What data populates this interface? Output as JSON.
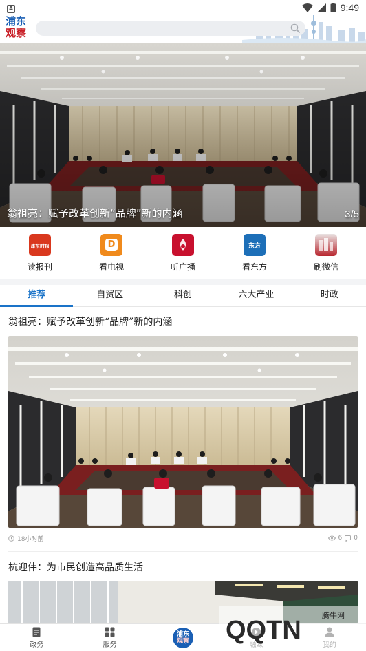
{
  "status_bar": {
    "time": "9:49",
    "icons": [
      "a-icon",
      "wifi-icon",
      "signal-icon",
      "battery-icon"
    ]
  },
  "header": {
    "logo_line1": "浦东",
    "logo_line2": "观察",
    "search": {
      "value": "",
      "placeholder": ""
    }
  },
  "banner": {
    "caption": "翁祖亮：赋予改革创新“品牌”新的内涵",
    "pager": "3/5"
  },
  "shortcuts": [
    {
      "label": "读报刊",
      "icon": "newspaper-icon",
      "color": "#d9381e",
      "glyph": "浦东时报"
    },
    {
      "label": "看电视",
      "icon": "tv-icon",
      "color": "#f08a1c",
      "glyph": "D"
    },
    {
      "label": "听广播",
      "icon": "radio-icon",
      "color": "#c8102e",
      "glyph": ""
    },
    {
      "label": "看东方",
      "icon": "east-icon",
      "color": "#1d6fb8",
      "glyph": "东方"
    },
    {
      "label": "刷微信",
      "icon": "wechat-icon",
      "color": "#b8262e",
      "glyph": ""
    }
  ],
  "tabs": [
    {
      "label": "推荐",
      "active": true
    },
    {
      "label": "自贸区",
      "active": false
    },
    {
      "label": "科创",
      "active": false
    },
    {
      "label": "六大产业",
      "active": false
    },
    {
      "label": "时政",
      "active": false
    }
  ],
  "articles": [
    {
      "title": "翁祖亮：赋予改革创新“品牌”新的内涵",
      "time": "18小时前",
      "views": "6",
      "comments": "0"
    },
    {
      "title": "杭迎伟：为市民创造高品质生活"
    }
  ],
  "bottom_nav": [
    {
      "label": "政务",
      "icon": "document-icon"
    },
    {
      "label": "服务",
      "icon": "grid-icon"
    },
    {
      "label": "",
      "icon": "center-logo-icon"
    },
    {
      "label": "融媒",
      "icon": "media-icon"
    },
    {
      "label": "我的",
      "icon": "user-icon"
    }
  ],
  "watermark": {
    "text": "腾牛网",
    "logo": "QQTN"
  },
  "colors": {
    "accent": "#1a73c8",
    "brand_blue": "#1a5fb4",
    "brand_red": "#c81d25"
  }
}
